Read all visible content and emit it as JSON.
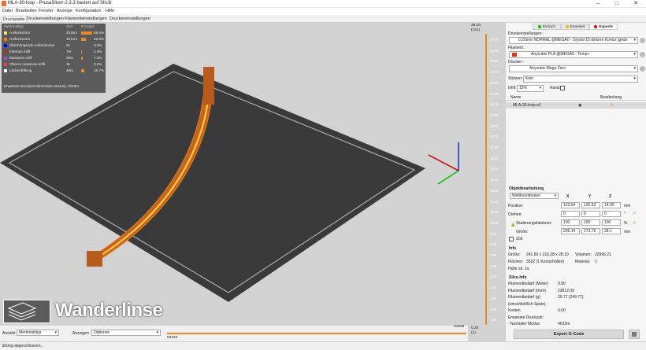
{
  "window": {
    "title": "MLA-30-loop - PrusaSlicer-2.3.3 basiert auf Slic3r",
    "controls": [
      "–",
      "□",
      "✕"
    ]
  },
  "menu": [
    "Datei",
    "Bearbeiten",
    "Fenster",
    "Anzeige",
    "Konfiguration",
    "Hilfe"
  ],
  "tabs": [
    "Druckplatte",
    "Druckeinstellungen",
    "Filamenteinstellungen",
    "Druckereinstellungen"
  ],
  "legend": {
    "headers": [
      "Merkmaltyp",
      "Zeit",
      "Prozent"
    ],
    "rows": [
      {
        "name": "Außenkontur",
        "time": "2h18m",
        "percent": "55.5%",
        "color": "#ffe680",
        "share": 55.5
      },
      {
        "name": "Außenkontur",
        "time": "1h12m",
        "percent": "22.9%",
        "color": "#ff8000",
        "share": 22.9
      },
      {
        "name": "Überhängende Außenkontur",
        "time": "2s",
        "percent": "0.0%",
        "color": "#0000ff",
        "share": 0
      },
      {
        "name": "Internes Infill",
        "time": "7m",
        "percent": "2.6%",
        "color": "#b03029",
        "share": 2.6
      },
      {
        "name": "Massives Infill",
        "time": "20m",
        "percent": "7.2%",
        "color": "#9654cc",
        "share": 7.2
      },
      {
        "name": "Oberes massives Infill",
        "time": "3s",
        "percent": "0.0%",
        "color": "#f04040",
        "share": 0
      },
      {
        "name": "Lückenfüllung",
        "time": "46m",
        "percent": "16.7%",
        "color": "#ffffff",
        "share": 16.7
      }
    ],
    "footer": "Erwartete Druckzeit (Normaler Modus):",
    "footer_value": "4h33m"
  },
  "brand": "Wanderlinse",
  "bottom": {
    "view_label": "Ansicht",
    "view_value": "Merkmalstyp",
    "show_label": "Anzeigen",
    "show_value": "Optionen",
    "hslider_low": "93423",
    "hslider_high": "94626"
  },
  "vslider": {
    "top": "28.20",
    "top_layer": "(141)",
    "bottom": "0.20",
    "bottom_layer": "(1)",
    "ticks": [
      "27.00",
      "26.00",
      "25.00",
      "24.00",
      "23.00",
      "22.00",
      "21.00",
      "20.00",
      "19.00",
      "18.00",
      "17.00",
      "16.00",
      "15.00",
      "14.00",
      "13.00",
      "12.00",
      "11.00",
      "10.00",
      "9.00",
      "8.00",
      "7.00",
      "6.00",
      "5.00",
      "4.00",
      "3.00",
      "2.00",
      "1.00"
    ]
  },
  "panel": {
    "modes": [
      {
        "label": "Einfach",
        "color": "#00c000"
      },
      {
        "label": "Erweitert",
        "color": "#e0c000"
      },
      {
        "label": "Experte",
        "color": "#e00000"
      }
    ],
    "print_settings_label": "Druckeinstellungen :",
    "print_settings_value": "0.20mm NORMAL @MEGA0 - Gyroid 15 dickere Kontur (geän",
    "filament_label": "Filament :",
    "filament_value": "Anycubic PLA @MEGA0 - Temp+",
    "filament_color": "#e03010",
    "printer_label": "Drucker :",
    "printer_value": "Anycubic Mega Zero",
    "supports_label": "Stützen:",
    "supports_value": "Kein",
    "infill_label": "Infill:",
    "infill_value": "15%",
    "brim_label": "Rand:",
    "object_list_headers": [
      "Name",
      "Bearbeitung"
    ],
    "object_name": "MLA-30-loop.stl",
    "manip_title": "Objektbearbeitung",
    "coord_system": "Weltkoordinaten",
    "axes": [
      "X",
      "Y",
      "Z"
    ],
    "position_label": "Position:",
    "position": [
      "123.64",
      "125.63",
      "14.05"
    ],
    "position_unit": "mm",
    "rotation_label": "Drehen:",
    "rotation": [
      "0",
      "0",
      "0"
    ],
    "rotation_unit": "°",
    "scale_label": "Skalierungsfaktoren:",
    "scale": [
      "100",
      "100",
      "100"
    ],
    "scale_unit": "%",
    "size_label": "Größe:",
    "size": [
      "206.14",
      "173.76",
      "28.1"
    ],
    "size_unit": "mm",
    "inch_label": "Zoll",
    "info_title": "Info",
    "info_size_label": "Größe:",
    "info_size_value": "241.83 x 216.28 x 28.10",
    "info_volume_label": "Volumen:",
    "info_volume_value": "22996.21",
    "info_facets_label": "Flächen:",
    "info_facets_value": "3522 (1 Konturhüllen)",
    "info_material_label": "Material:",
    "info_material_value": "1",
    "info_ok": "Hülle ok: Ja",
    "slice_title": "Slice-Info",
    "slice_rows": [
      {
        "k": "Filamentbedarf (Meter)",
        "v": "9.90"
      },
      {
        "k": "Filamentbedarf (mm³)",
        "v": "23812.09"
      },
      {
        "k": "Filamentbedarf (g)",
        "v": "29.77 (249.77)"
      },
      {
        "k": "(einschließlich Spule)",
        "v": ""
      },
      {
        "k": "Kosten",
        "v": "0.60"
      },
      {
        "k": "Erwartete Druckzeit:",
        "v": ""
      },
      {
        "k": "- Normaler Modus",
        "v": "4h33m"
      }
    ],
    "export_label": "Export G-Code"
  },
  "status": "Slicing abgeschlossen..."
}
